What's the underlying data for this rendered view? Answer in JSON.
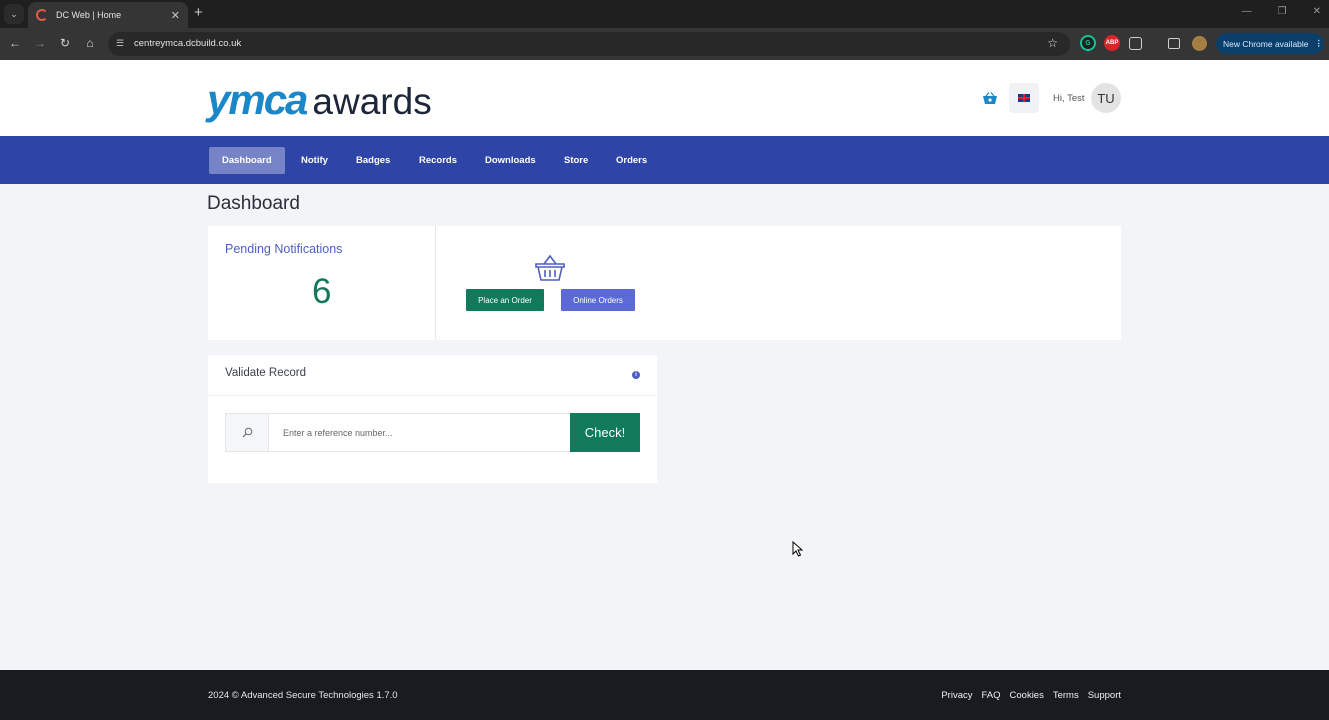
{
  "browser": {
    "tab_title": "DC Web | Home",
    "tab_close": "✕",
    "new_tab": "+",
    "url": "centreymca.dcbuild.co.uk",
    "update_button": "New Chrome available"
  },
  "header": {
    "logo_ymca": "ymca",
    "logo_awards": "awards",
    "greeting_prefix": "Hi,",
    "user_name": "Test",
    "avatar_initials": "TU"
  },
  "nav": {
    "items": [
      {
        "label": "Dashboard",
        "active": true
      },
      {
        "label": "Notify",
        "active": false
      },
      {
        "label": "Badges",
        "active": false
      },
      {
        "label": "Records",
        "active": false
      },
      {
        "label": "Downloads",
        "active": false
      },
      {
        "label": "Store",
        "active": false
      },
      {
        "label": "Orders",
        "active": false
      }
    ]
  },
  "main": {
    "page_title": "Dashboard",
    "pending": {
      "label": "Pending Notifications",
      "count": "6"
    },
    "orders": {
      "place_order_label": "Place an Order",
      "online_orders_label": "Online Orders"
    },
    "validate": {
      "title": "Validate Record",
      "input_placeholder": "Enter a reference number...",
      "check_label": "Check!"
    }
  },
  "footer": {
    "copyright": "2024 © Advanced Secure Technologies 1.7.0",
    "links": [
      "Privacy",
      "FAQ",
      "Cookies",
      "Terms",
      "Support"
    ]
  },
  "colors": {
    "nav_bg": "#2f44a7",
    "nav_active": "#7683c6",
    "primary_green": "#117a5a",
    "accent_blue": "#4e5ec0",
    "logo_blue": "#1b87c9",
    "footer_bg": "#1a1b20"
  }
}
